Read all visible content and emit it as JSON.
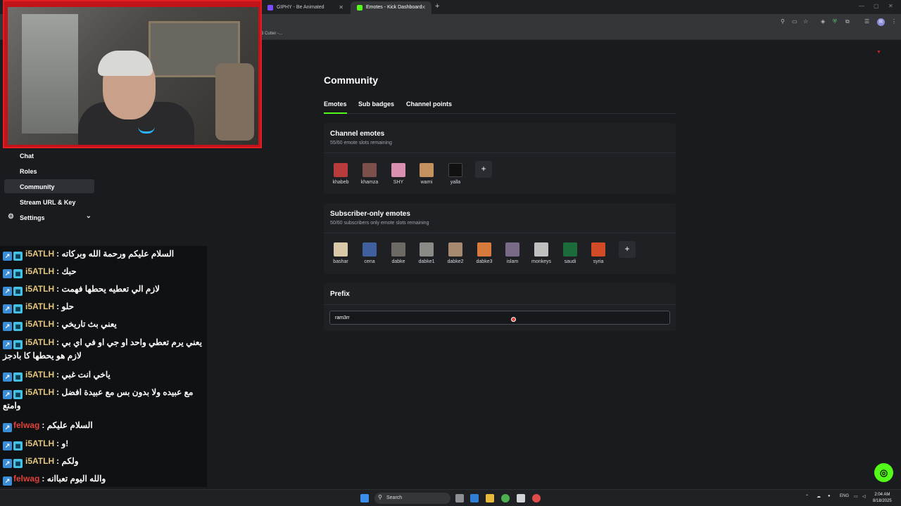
{
  "browser": {
    "tabs": [
      {
        "label": "GIPHY - Be Animated",
        "favicon_color": "#7d4cff"
      },
      {
        "label": "Emotes - Kick Dashboard",
        "favicon_color": "#53fc18"
      }
    ],
    "new_tab": "+",
    "bookmark_text": "3 Cutter -...",
    "profile_initial": "R"
  },
  "sidebar": {
    "items": [
      {
        "label": "Chat"
      },
      {
        "label": "Roles"
      },
      {
        "label": "Community"
      },
      {
        "label": "Stream URL & Key"
      },
      {
        "label": "Settings"
      }
    ]
  },
  "chat": {
    "messages": [
      {
        "user": "i5ATLH",
        "text": ": السلام عليكم ورحمة الله وبركاته"
      },
      {
        "user": "i5ATLH",
        "text": ": حبك"
      },
      {
        "user": "i5ATLH",
        "text": ": لازم الي تعطيه يحطها فهمت"
      },
      {
        "user": "i5ATLH",
        "text": ": حلو"
      },
      {
        "user": "i5ATLH",
        "text": ": يعني بث تاريخي"
      },
      {
        "user": "i5ATLH",
        "text": ": يعني يرم تعطي واحد او جي او في اي بي",
        "cont": "لازم هو يحطها كا بادجز"
      },
      {
        "user": "i5ATLH",
        "text": ": ياخي انت غبي"
      },
      {
        "user": "i5ATLH",
        "text": ": مع عبيده ولا بدون بس مع عبيدة افضل",
        "cont": "وامتع"
      },
      {
        "user": "felwag",
        "text": ": السلام عليكم"
      },
      {
        "user": "i5ATLH",
        "text": ": و!"
      },
      {
        "user": "i5ATLH",
        "text": ": ولكم"
      },
      {
        "user": "felwag",
        "text": ": والله اليوم تعباانه"
      }
    ]
  },
  "main": {
    "title": "Community",
    "tabs": [
      {
        "label": "Emotes"
      },
      {
        "label": "Sub badges"
      },
      {
        "label": "Channel points"
      }
    ],
    "channel_emotes": {
      "title": "Channel emotes",
      "subtitle": "55/60 emote slots remaining",
      "emotes": [
        {
          "name": "khabeb",
          "color": "#b93b3b"
        },
        {
          "name": "khamza",
          "color": "#7d4f4a"
        },
        {
          "name": "SHY",
          "color": "#d98fb0"
        },
        {
          "name": "warni",
          "color": "#c4925f"
        },
        {
          "name": "yalla",
          "color": "#111111"
        }
      ],
      "add": "+"
    },
    "sub_emotes": {
      "title": "Subscriber-only emotes",
      "subtitle": "50/60 subscribers only emote slots remaining",
      "emotes": [
        {
          "name": "bashar",
          "color": "#d9c9a8"
        },
        {
          "name": "cena",
          "color": "#3f5f9f"
        },
        {
          "name": "dabke",
          "color": "#6d6a66"
        },
        {
          "name": "dabke1",
          "color": "#8a8a86"
        },
        {
          "name": "dabke2",
          "color": "#a7896f"
        },
        {
          "name": "dabke3",
          "color": "#d77a3c"
        },
        {
          "name": "islam",
          "color": "#7a6a8a"
        },
        {
          "name": "monkeys",
          "color": "#bfbfbf"
        },
        {
          "name": "saudi",
          "color": "#1c6b3a"
        },
        {
          "name": "syria",
          "color": "#d14b27"
        }
      ],
      "add": "+"
    },
    "prefix": {
      "title": "Prefix",
      "value": "ram3rr"
    }
  },
  "taskbar": {
    "search": "Search",
    "lang": "ENG",
    "time": "2:04 AM",
    "date": "8/18/2025"
  },
  "colors": {
    "accent": "#53fc18",
    "cam_border": "#e41d22"
  }
}
